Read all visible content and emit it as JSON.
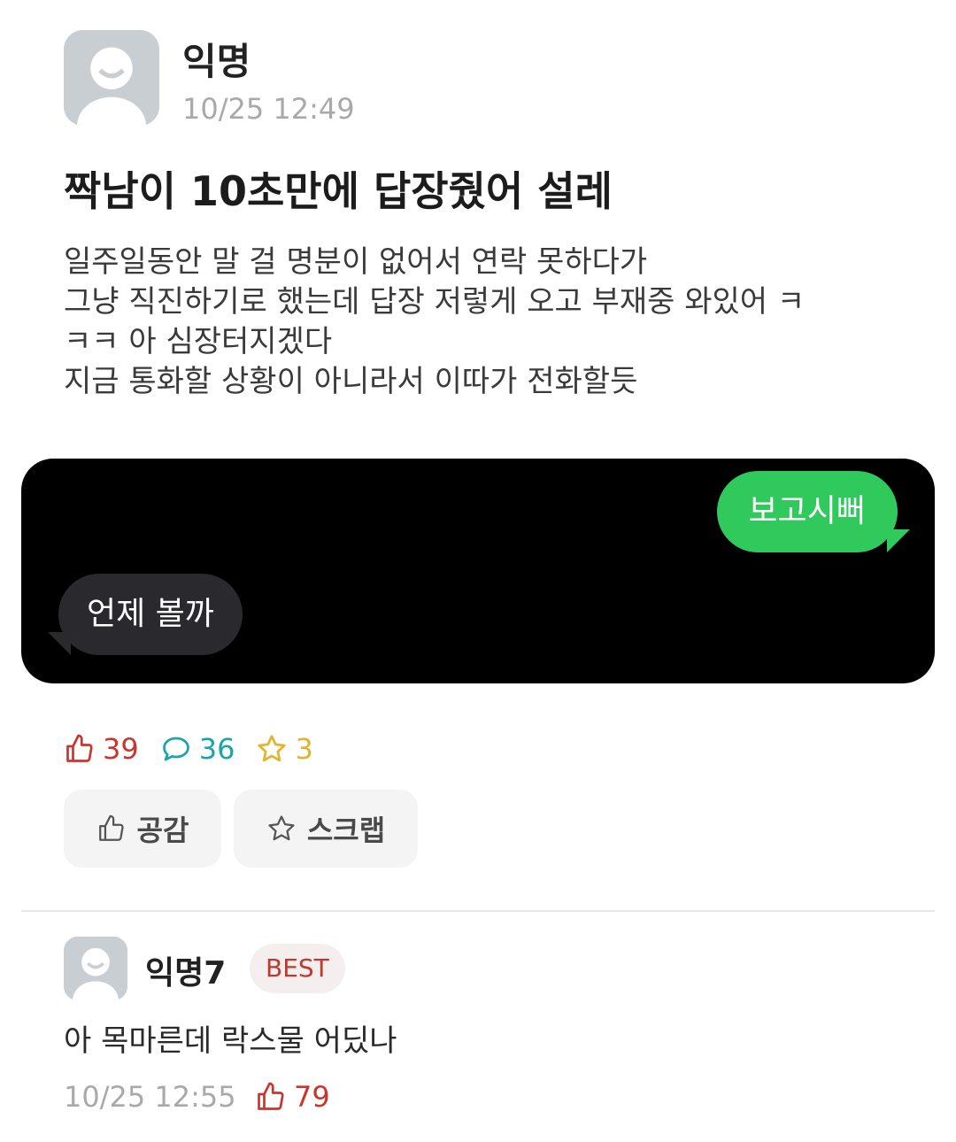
{
  "post": {
    "author": "익명",
    "time": "10/25 12:49",
    "title": "짝남이 10초만에 답장줬어 설레",
    "body_lines": [
      "일주일동안 말 걸 명분이 없어서 연락 못하다가",
      "그냥 직진하기로 했는데 답장 저렇게 오고 부재중 와있어 ㅋ",
      "ㅋㅋ 아 심장터지겠다",
      "지금 통화할 상황이 아니라서 이따가 전화할듯"
    ]
  },
  "chat": {
    "sent": "보고시뻐",
    "received": "언제 볼까"
  },
  "stats": {
    "likes": "39",
    "comments": "36",
    "scraps": "3"
  },
  "actions": {
    "like_label": "공감",
    "scrap_label": "스크랩"
  },
  "comment": {
    "author": "익명7",
    "badge": "BEST",
    "text": "아 목마른데 락스물 어딨나",
    "time": "10/25 12:55",
    "likes": "79"
  },
  "colors": {
    "like": "#c8372d",
    "comment": "#1aa5ad",
    "scrap": "#e0b52c",
    "sent_bubble": "#2fc95c",
    "received_bubble": "#2a2a2e"
  }
}
